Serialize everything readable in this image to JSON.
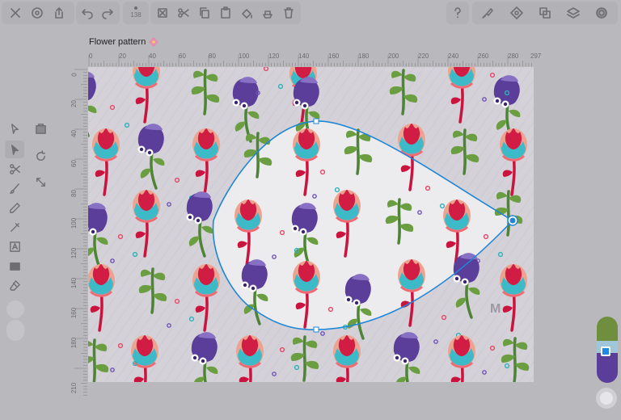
{
  "toolbar": {
    "left_icons": [
      "close-icon",
      "settings-icon",
      "share-icon"
    ],
    "history_icons": [
      "undo-icon",
      "redo-icon"
    ],
    "zoom_value": "138",
    "edit_icons": [
      "clear-icon",
      "cut-icon",
      "copy-icon",
      "paste-icon",
      "fill-icon",
      "erase-layer-icon",
      "delete-icon"
    ],
    "right_icons": [
      "help-icon",
      "brush-settings-icon",
      "transform-icon",
      "arrange-icon",
      "layers-icon",
      "color-icon"
    ]
  },
  "document": {
    "title": "Flower pattern"
  },
  "ruler": {
    "horizontal": [
      "0",
      "20",
      "40",
      "60",
      "80",
      "100",
      "120",
      "140",
      "160",
      "180",
      "200",
      "220",
      "240",
      "260",
      "280",
      "297"
    ],
    "vertical": [
      "0",
      "20",
      "40",
      "60",
      "80",
      "100",
      "120",
      "140",
      "160",
      "180",
      "210"
    ]
  },
  "tools": [
    "select-icon",
    "direct-select-icon",
    "scissors-icon",
    "brush-icon",
    "pencil-icon",
    "pen-icon",
    "text-icon",
    "rectangle-icon",
    "eraser-icon",
    "artboard-icon",
    "rotate-icon",
    "scale-icon"
  ],
  "colors": {
    "accent": "#1e8ce6",
    "selection_path": "#1f86d6",
    "canvas_bg": "#d4d2d8",
    "app_bg": "#b9b8bc"
  },
  "watermark": "M"
}
